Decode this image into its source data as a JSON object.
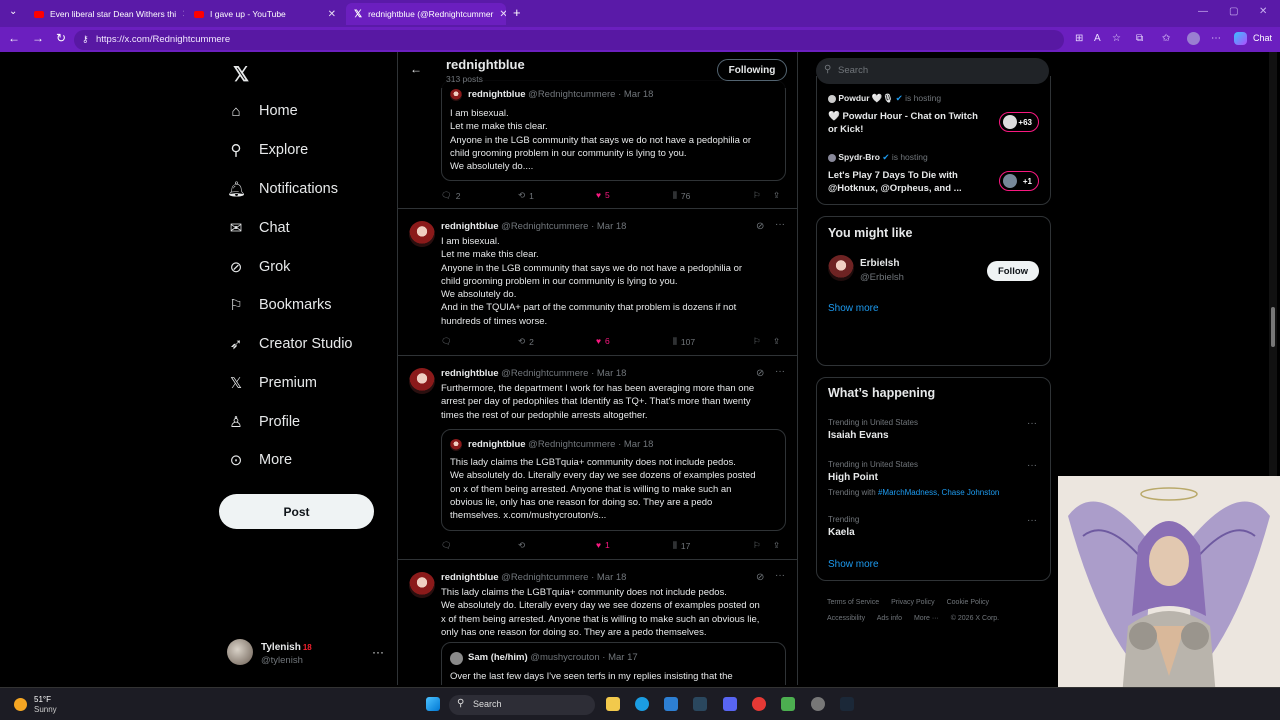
{
  "browser": {
    "tabs": [
      {
        "title": "Even liberal star Dean Withers thi"
      },
      {
        "title": "I gave up - YouTube"
      },
      {
        "title": "rednightblue (@Rednightcummer"
      }
    ],
    "url": "https://x.com/Rednightcummere",
    "chat_label": "Chat"
  },
  "nav": {
    "items": [
      {
        "label": "Home",
        "icon": "home-icon"
      },
      {
        "label": "Explore",
        "icon": "search-icon"
      },
      {
        "label": "Notifications",
        "icon": "bell-icon"
      },
      {
        "label": "Chat",
        "icon": "mail-icon"
      },
      {
        "label": "Grok",
        "icon": "grok-icon"
      },
      {
        "label": "Bookmarks",
        "icon": "bookmark-icon"
      },
      {
        "label": "Creator Studio",
        "icon": "rocket-icon"
      },
      {
        "label": "Premium",
        "icon": "x-icon"
      },
      {
        "label": "Profile",
        "icon": "person-icon"
      },
      {
        "label": "More",
        "icon": "more-circle-icon"
      }
    ],
    "post_label": "Post",
    "account": {
      "name": "Tylenish",
      "badge": "18",
      "handle": "@tylenish"
    }
  },
  "timeline": {
    "title": "rednightblue",
    "posts_count": "313 posts",
    "following_label": "Following",
    "tweets": [
      {
        "name": "rednightblue",
        "handle": "@Rednightcummere",
        "date": "Mar 18",
        "lines": [
          "I am bisexual.",
          "Let me make this clear.",
          "Anyone in the LGB community that says we do not have a pedophilia or",
          "child grooming problem in our community is lying to you.",
          "We absolutely do...."
        ],
        "replies": "2",
        "reposts": "1",
        "likes": "5",
        "views": "76"
      },
      {
        "name": "rednightblue",
        "handle": "@Rednightcummere",
        "date": "Mar 18",
        "lines": [
          "I am bisexual.",
          "Let me make this clear.",
          "Anyone in the LGB community that says we do not have a pedophilia or",
          "child grooming problem in our community is lying to you.",
          "We absolutely do.",
          "And in the TQUIA+ part of the community that problem is dozens if not",
          "hundreds of times worse."
        ],
        "replies": "",
        "reposts": "2",
        "likes": "6",
        "views": "107"
      },
      {
        "name": "rednightblue",
        "handle": "@Rednightcummere",
        "date": "Mar 18",
        "lines": [
          "Furthermore, the department I work for has been averaging more than one",
          "arrest per day of pedophiles that Identify as TQ+. That's more than twenty",
          "times the rest of our pedophile arrests altogether."
        ],
        "quote": {
          "name": "rednightblue",
          "handle": "@Rednightcummere",
          "date": "Mar 18",
          "lines": [
            "This lady claims the LGBTquia+ community does not include pedos.",
            "We absolutely do. Literally every day we see dozens of examples posted",
            "on x of them being arrested. Anyone that is willing to make such an",
            "obvious lie, only has one reason for doing so. They are a pedo",
            "themselves. x.com/mushycrouton/s..."
          ]
        },
        "replies": "",
        "reposts": "",
        "likes": "1",
        "views": "17"
      },
      {
        "name": "rednightblue",
        "handle": "@Rednightcummere",
        "date": "Mar 18",
        "lines": [
          "This lady claims the LGBTquia+ community does not include pedos.",
          "We absolutely do. Literally every day we see dozens of examples posted on",
          "x of them being arrested. Anyone that is willing to make such an obvious lie,",
          "only has one reason for doing so. They are a pedo themselves."
        ],
        "quote": {
          "name": "Sam (he/him)",
          "handle": "@mushycrouton",
          "date": "Mar 17",
          "lines": [
            "Over the last few days I've seen terfs in my replies insisting that the"
          ]
        }
      }
    ]
  },
  "sidebar": {
    "search_placeholder": "Search",
    "spaces": [
      {
        "host": "Powdur 🤍🎙",
        "suffix": "is hosting",
        "title": "🤍 Powdur Hour - Chat on Twitch or  Kick!",
        "count": "+63"
      },
      {
        "host": "Spydr-Bro",
        "suffix": "is hosting",
        "title": "Let's Play 7 Days To Die with @Hotknux, @Orpheus, and ...",
        "count": "+1"
      }
    ],
    "might_like": {
      "title": "You might like",
      "name": "Erbielsh",
      "handle": "@Erbielsh",
      "follow_label": "Follow",
      "show_more": "Show more"
    },
    "happening": {
      "title": "What’s happening",
      "trends": [
        {
          "context": "Trending in United States",
          "name": "Isaiah Evans"
        },
        {
          "context": "Trending in United States",
          "name": "High Point",
          "with_prefix": "Trending with",
          "with_tags": "#MarchMadness, Chase Johnston"
        },
        {
          "context": "Trending",
          "name": "Kaela"
        }
      ],
      "show_more": "Show more"
    },
    "footer": [
      "Terms of Service",
      "Privacy Policy",
      "Cookie Policy",
      "Accessibility",
      "Ads info",
      "More ···",
      "© 2026 X Corp."
    ]
  },
  "taskbar": {
    "temp": "51°F",
    "condition": "Sunny",
    "search_label": "Search"
  }
}
